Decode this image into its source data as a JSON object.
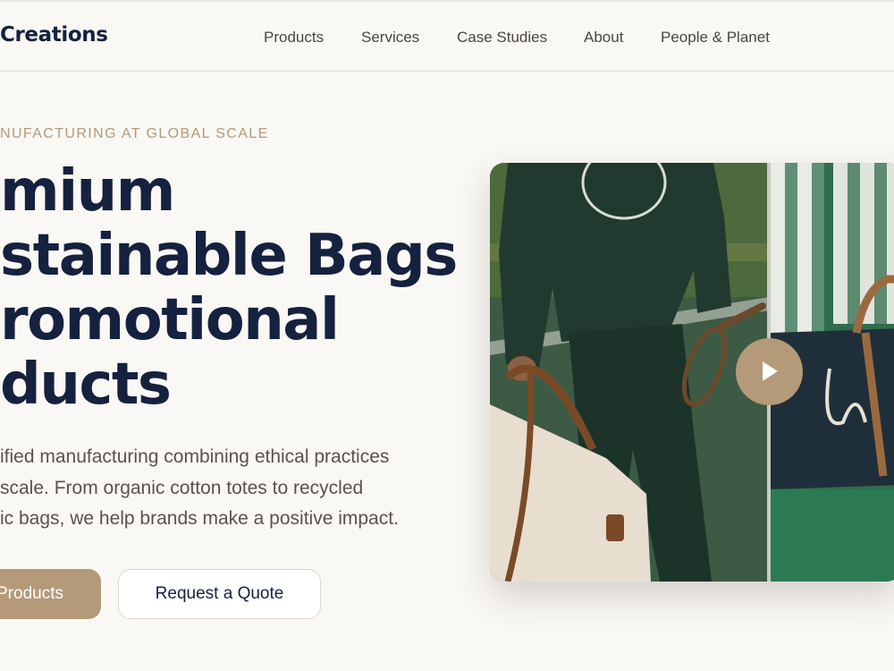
{
  "header": {
    "logo": "Creations",
    "nav": [
      {
        "label": "Products"
      },
      {
        "label": "Services"
      },
      {
        "label": "Case Studies"
      },
      {
        "label": "About"
      },
      {
        "label": "People & Planet"
      }
    ]
  },
  "hero": {
    "eyebrow": "NUFACTURING AT GLOBAL SCALE",
    "headline_lines": [
      "mium",
      "stainable Bags",
      "romotional",
      "ducts"
    ],
    "description_lines": [
      "ified manufacturing combining ethical practices",
      "scale. From organic cotton totes to recycled",
      "ic bags, we help brands make a positive impact."
    ],
    "primary_button": "Products",
    "secondary_button": "Request a Quote"
  },
  "media": {
    "play_icon": "play-icon"
  },
  "colors": {
    "background": "#faf8f4",
    "navy": "#15213f",
    "accent": "#b49a78",
    "body_text": "#5b5249"
  }
}
